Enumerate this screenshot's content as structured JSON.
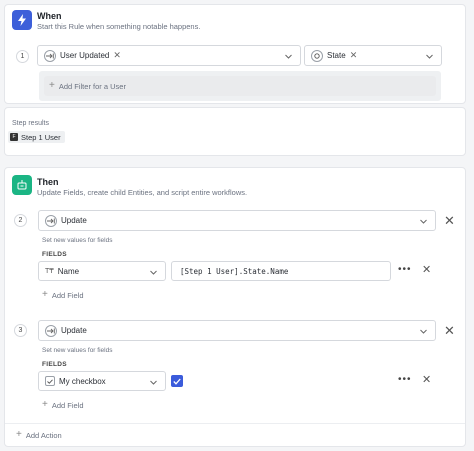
{
  "when": {
    "title": "When",
    "subtitle": "Start this Rule when something notable happens.",
    "step_number": "1",
    "trigger_label": "User Updated",
    "field_label": "State",
    "add_filter": "Add Filter for a User"
  },
  "results": {
    "label": "Step results",
    "badge_text": "Step 1 User",
    "badge_glyph": "F"
  },
  "then": {
    "title": "Then",
    "subtitle": "Update Fields, create child Entities, and script entire workflows.",
    "steps": [
      {
        "number": "2",
        "action": "Update",
        "hint": "Set new values for fields",
        "fields_label": "FIELDS",
        "field_name": "Name",
        "field_value": "[Step 1 User].State.Name",
        "add_field": "Add Field"
      },
      {
        "number": "3",
        "action": "Update",
        "hint": "Set new values for fields",
        "fields_label": "FIELDS",
        "field_name": "My checkbox",
        "field_checked": true,
        "add_field": "Add Field"
      }
    ],
    "add_action": "Add Action"
  },
  "colors": {
    "when_icon": "#3d5fd9",
    "then_icon": "#1bb584",
    "checkbox": "#3b5bdb"
  },
  "icons": [
    "lightning-icon",
    "robot-icon",
    "arrow-into-icon",
    "circle-a-icon",
    "text-type-icon",
    "checkbox-icon",
    "chevron-down-icon",
    "close-icon",
    "more-dots-icon",
    "plus-icon"
  ]
}
